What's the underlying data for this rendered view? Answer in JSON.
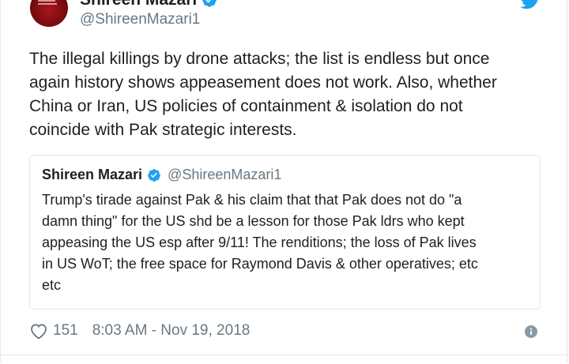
{
  "author": {
    "name": "Shireen Mazari",
    "handle": "@ShireenMazari1",
    "verified_icon": "verified-badge-icon",
    "platform_icon": "twitter-bird-icon"
  },
  "tweet": {
    "lines": [
      "The illegal killings by drone attacks; the list is endless but once",
      "again history shows appeasement does not work. Also, whether",
      "China or Iran, US policies of containment & isolation do not",
      "coincide with Pak strategic interests."
    ]
  },
  "quoted_tweet": {
    "name": "Shireen Mazari",
    "handle": "@ShireenMazari1",
    "lines": [
      "Trump's tirade against Pak & his claim that that Pak does not do \"a",
      "damn thing\" for the US shd be a lesson for those Pak ldrs who kept",
      "appeasing the US esp after 9/11! The renditions; the loss of Pak lives",
      "in US WoT; the free space for Raymond Davis & other operatives; etc",
      "etc"
    ]
  },
  "footer": {
    "like_count": "151",
    "timestamp": "8:03 AM - Nov 19, 2018",
    "info_icon": "info-icon",
    "heart_icon": "heart-icon"
  },
  "colors": {
    "accent": "#1da1f2",
    "text": "#1c2022",
    "muted": "#697882",
    "border": "#e1e8ed"
  }
}
